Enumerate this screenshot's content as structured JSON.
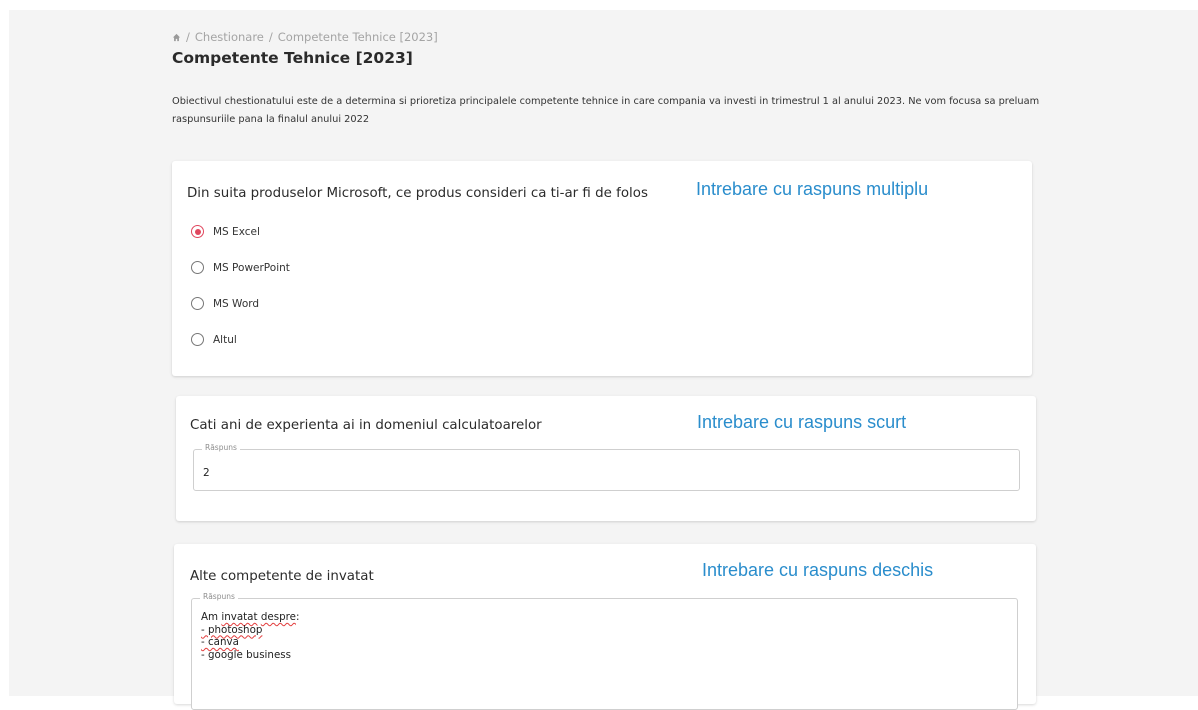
{
  "breadcrumb": {
    "home_icon": "home-icon",
    "separator": "/",
    "items": [
      "Chestionare",
      "Competente Tehnice [2023]"
    ]
  },
  "page": {
    "title": "Competente Tehnice [2023]",
    "description": "Obiectivul chestionatului este de a determina si prioretiza principalele competente tehnice in care compania va investi in trimestrul 1 al anului 2023. Ne vom focusa sa preluam raspunsuriile pana la finalul anului 2022"
  },
  "questions": [
    {
      "title": "Din suita produselor Microsoft, ce produs consideri ca ti-ar fi de folos",
      "annotation": "Intrebare cu raspuns multiplu",
      "options": [
        "MS Excel",
        "MS PowerPoint",
        "MS Word",
        "Altul"
      ],
      "selected": "MS Excel"
    },
    {
      "title": "Cati ani de experienta ai in domeniul calculatoarelor",
      "annotation": "Intrebare cu raspuns scurt",
      "field_label": "Răspuns",
      "value": "2"
    },
    {
      "title": "Alte competente de invatat",
      "annotation": "Intrebare cu raspuns deschis",
      "field_label": "Răspuns",
      "lines": {
        "l1_a": "Am ",
        "l1_b": "invatat",
        "l1_c": " ",
        "l1_d": "despre",
        "l1_e": ":",
        "l2": "- photoshop",
        "l3": "- canva",
        "l4": "- google business"
      }
    }
  ],
  "colors": {
    "accent_radio": "#e0475e",
    "annotation": "#2a8dcc",
    "spellcheck": "#e23b3b"
  }
}
